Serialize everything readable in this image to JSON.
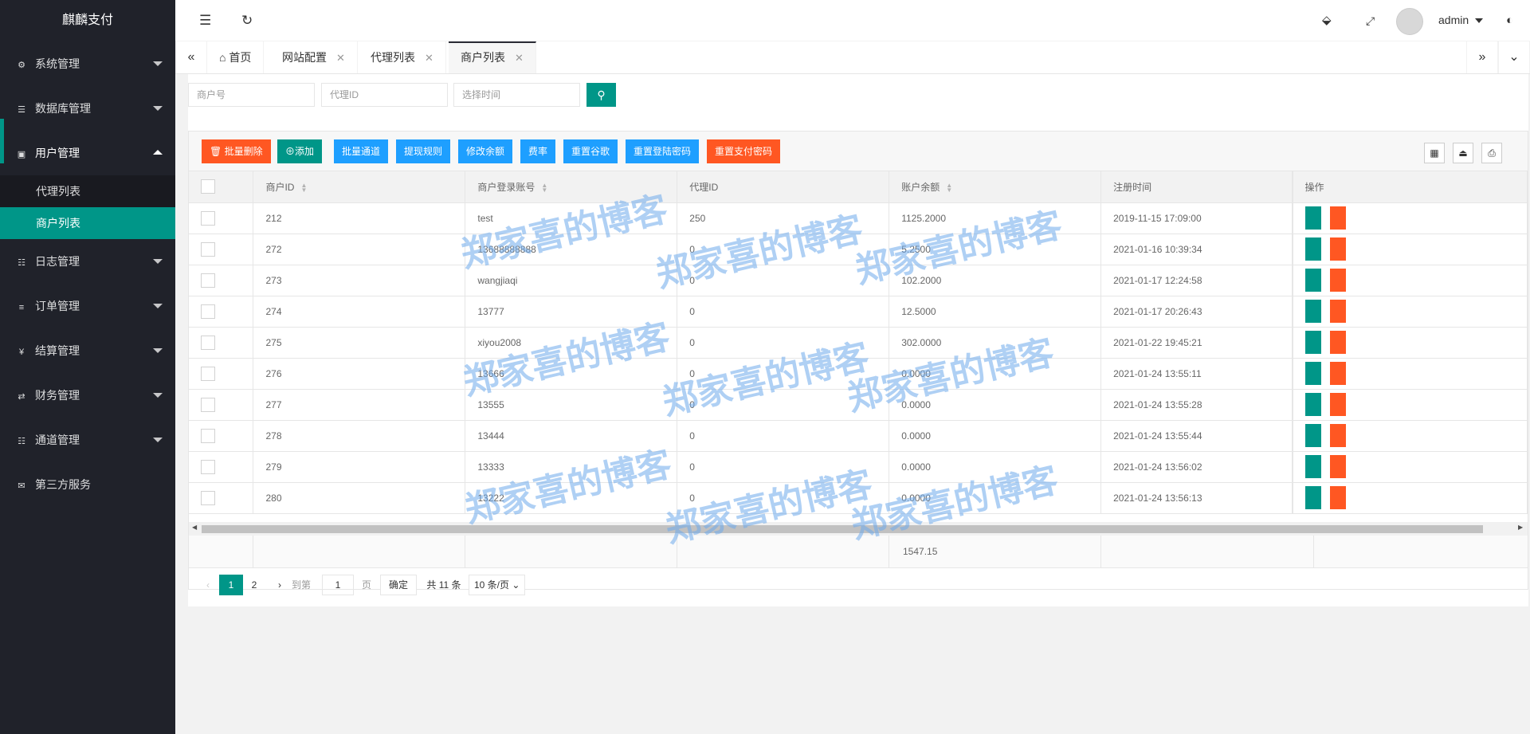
{
  "app_title": "麒麟支付",
  "sidebar": {
    "items": [
      {
        "label": "系统管理",
        "icon": "gear-icon"
      },
      {
        "label": "数据库管理",
        "icon": "database-icon"
      },
      {
        "label": "用户管理",
        "icon": "users-icon",
        "open": true
      },
      {
        "label": "日志管理",
        "icon": "log-icon"
      },
      {
        "label": "订单管理",
        "icon": "list-icon"
      },
      {
        "label": "结算管理",
        "icon": "yen-icon"
      },
      {
        "label": "财务管理",
        "icon": "transfer-icon"
      },
      {
        "label": "通道管理",
        "icon": "channel-icon"
      },
      {
        "label": "第三方服务",
        "icon": "mail-icon"
      }
    ],
    "submenu": [
      {
        "label": "代理列表"
      },
      {
        "label": "商户列表",
        "active": true
      }
    ]
  },
  "header": {
    "user": "admin"
  },
  "tabs": [
    {
      "label": "首页"
    },
    {
      "label": "网站配置"
    },
    {
      "label": "代理列表"
    },
    {
      "label": "商户列表",
      "active": true
    }
  ],
  "search": {
    "merchant_no_placeholder": "商户号",
    "agent_id_placeholder": "代理ID",
    "time_placeholder": "选择时间"
  },
  "toolbar": {
    "batch_delete": "批量删除",
    "add": "添加",
    "batch_channel": "批量通道",
    "withdraw_rule": "提现规则",
    "modify_balance": "修改余额",
    "rate": "费率",
    "reset_google": "重置谷歌",
    "reset_login_pwd": "重置登陆密码",
    "reset_pay_pwd": "重置支付密码"
  },
  "table": {
    "headers": [
      "商户ID",
      "商户登录账号",
      "代理ID",
      "账户余额",
      "注册时间",
      "操作"
    ],
    "rows": [
      [
        "212",
        "test",
        "250",
        "1125.2000",
        "2019-11-15 17:09:00"
      ],
      [
        "272",
        "13688888888",
        "0",
        "5.2500",
        "2021-01-16 10:39:34"
      ],
      [
        "273",
        "wangjiaqi",
        "0",
        "102.2000",
        "2021-01-17 12:24:58"
      ],
      [
        "274",
        "13777",
        "0",
        "12.5000",
        "2021-01-17 20:26:43"
      ],
      [
        "275",
        "xiyou2008",
        "0",
        "302.0000",
        "2021-01-22 19:45:21"
      ],
      [
        "276",
        "13666",
        "0",
        "0.0000",
        "2021-01-24 13:55:11"
      ],
      [
        "277",
        "13555",
        "0",
        "0.0000",
        "2021-01-24 13:55:28"
      ],
      [
        "278",
        "13444",
        "0",
        "0.0000",
        "2021-01-24 13:55:44"
      ],
      [
        "279",
        "13333",
        "0",
        "0.0000",
        "2021-01-24 13:56:02"
      ],
      [
        "280",
        "13222",
        "0",
        "0.0000",
        "2021-01-24 13:56:13"
      ]
    ],
    "total_balance": "1547.15"
  },
  "pager": {
    "current": "1",
    "page2": "2",
    "goto_label": "到第",
    "goto_value": "1",
    "page_unit": "页",
    "ok": "确定",
    "total": "共 11 条",
    "per_page": "10 条/页"
  },
  "watermark": "郑家喜的博客",
  "colors": {
    "sidebar_bg": "#20222a",
    "accent": "#009688",
    "danger": "#ff5722",
    "info": "#1e9fff"
  }
}
